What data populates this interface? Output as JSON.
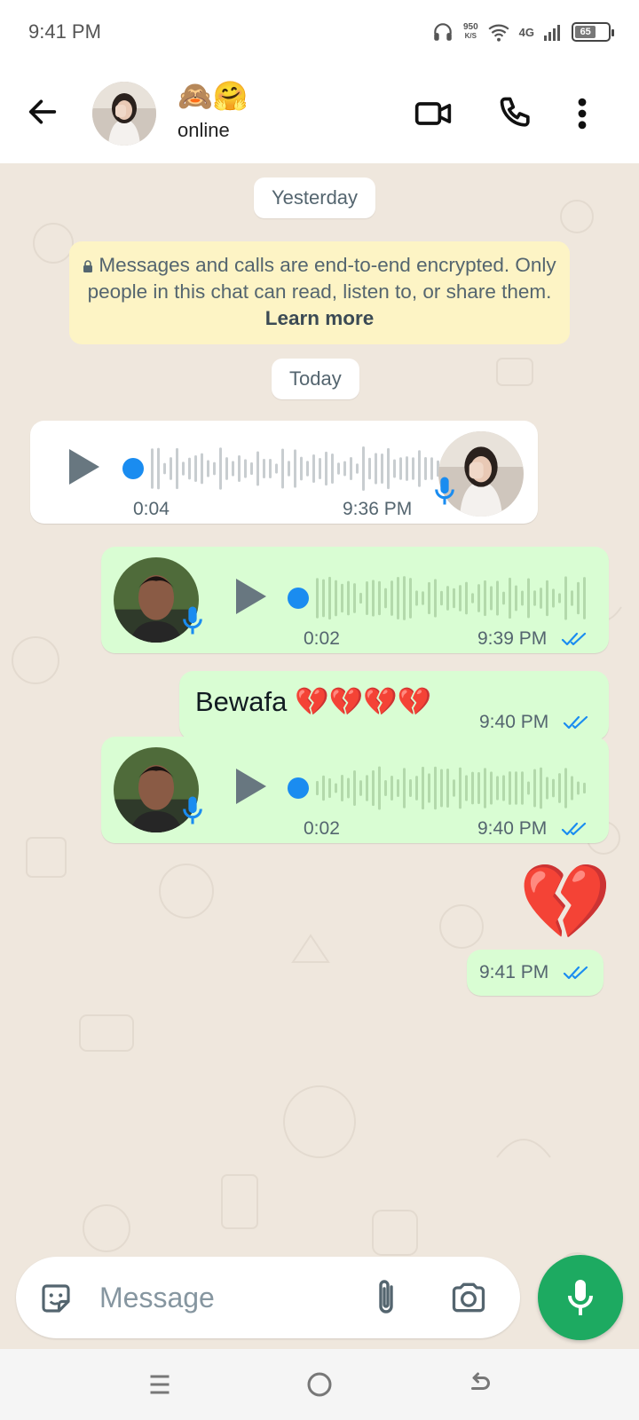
{
  "status_bar": {
    "time": "9:41 PM",
    "speed_value": "950",
    "speed_unit": "K/S",
    "network": "4G",
    "battery": "65"
  },
  "header": {
    "contact_name": "🙈🤗",
    "status": "online",
    "icons": [
      "back-arrow-icon",
      "video-call-icon",
      "phone-icon",
      "more-vert-icon"
    ]
  },
  "chat": {
    "day1": "Yesterday",
    "encryption_notice": "Messages and calls are end-to-end encrypted. Only people in this chat can read, listen to, or share them.",
    "learn_more": "Learn more",
    "day2": "Today",
    "messages": [
      {
        "type": "voice",
        "direction": "incoming",
        "duration": "0:04",
        "time": "9:36 PM",
        "progress": 0
      },
      {
        "type": "voice",
        "direction": "outgoing",
        "duration": "0:02",
        "time": "9:39 PM",
        "read": true,
        "progress": 0
      },
      {
        "type": "text",
        "direction": "outgoing",
        "text": "Bewafa 💔💔💔💔",
        "time": "9:40 PM",
        "read": true
      },
      {
        "type": "voice",
        "direction": "outgoing",
        "duration": "0:02",
        "time": "9:40 PM",
        "read": true,
        "progress": 0
      },
      {
        "type": "emoji",
        "direction": "outgoing",
        "text": "💔",
        "time": "9:41 PM",
        "read": true
      }
    ]
  },
  "input": {
    "placeholder": "Message",
    "icons": [
      "sticker-icon",
      "attach-icon",
      "camera-icon",
      "mic-icon"
    ]
  },
  "colors": {
    "chat_background": "#efe7dd",
    "outgoing_bubble": "#d9fdd3",
    "incoming_bubble": "#ffffff",
    "accent_blue": "#1a8cf0",
    "mic_button": "#1daa61"
  }
}
